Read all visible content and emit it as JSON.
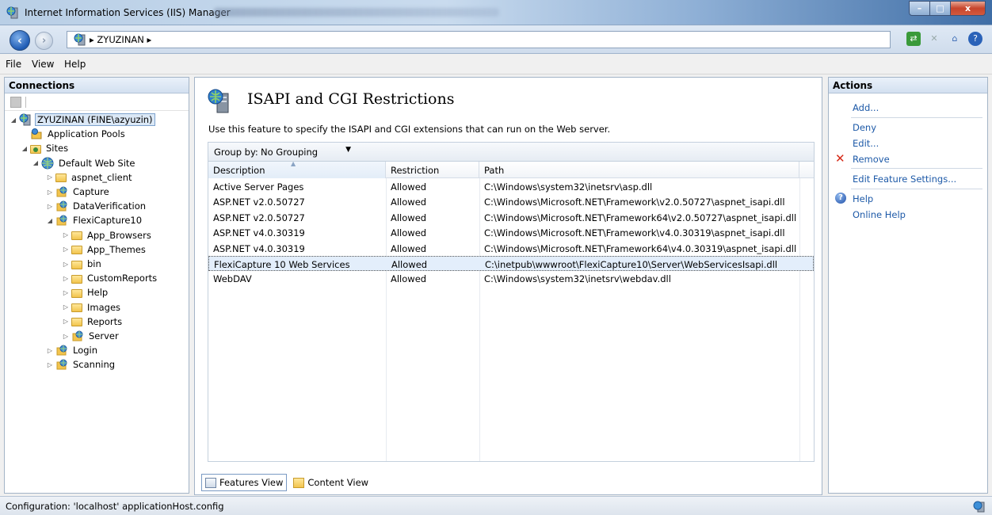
{
  "window": {
    "title": "Internet Information Services (IIS) Manager",
    "controls": {
      "minimize": "–",
      "maximize": "□",
      "close": "x"
    }
  },
  "address": {
    "crumb": "▸ ZYUZINAN ▸"
  },
  "menu": [
    {
      "label": "File"
    },
    {
      "label": "View"
    },
    {
      "label": "Help"
    }
  ],
  "connections": {
    "title": "Connections",
    "tree": [
      {
        "label": "ZYUZINAN (FINE\\azyuzin)",
        "icon": "server-icon",
        "level": 0,
        "expander": "◢",
        "selected": true
      },
      {
        "label": "Application Pools",
        "icon": "app-pools-icon",
        "level": 1,
        "expander": ""
      },
      {
        "label": "Sites",
        "icon": "sites-folder-icon",
        "level": 1,
        "expander": "◢"
      },
      {
        "label": "Default Web Site",
        "icon": "globe-icon",
        "level": 2,
        "expander": "◢"
      },
      {
        "label": "aspnet_client",
        "icon": "folder-icon",
        "level": 3,
        "expander": "▷"
      },
      {
        "label": "Capture",
        "icon": "web-app-icon",
        "level": 3,
        "expander": "▷"
      },
      {
        "label": "DataVerification",
        "icon": "web-app-icon",
        "level": 3,
        "expander": "▷"
      },
      {
        "label": "FlexiCapture10",
        "icon": "web-app-icon",
        "level": 3,
        "expander": "◢"
      },
      {
        "label": "App_Browsers",
        "icon": "folder-icon",
        "level": 4,
        "expander": "▷"
      },
      {
        "label": "App_Themes",
        "icon": "folder-icon",
        "level": 4,
        "expander": "▷"
      },
      {
        "label": "bin",
        "icon": "folder-icon",
        "level": 4,
        "expander": "▷"
      },
      {
        "label": "CustomReports",
        "icon": "folder-icon",
        "level": 4,
        "expander": "▷"
      },
      {
        "label": "Help",
        "icon": "folder-icon",
        "level": 4,
        "expander": "▷"
      },
      {
        "label": "Images",
        "icon": "folder-icon",
        "level": 4,
        "expander": "▷"
      },
      {
        "label": "Reports",
        "icon": "folder-icon",
        "level": 4,
        "expander": "▷"
      },
      {
        "label": "Server",
        "icon": "web-app-icon",
        "level": 4,
        "expander": "▷"
      },
      {
        "label": "Login",
        "icon": "web-app-icon",
        "level": 3,
        "expander": "▷"
      },
      {
        "label": "Scanning",
        "icon": "web-app-icon",
        "level": 3,
        "expander": "▷"
      }
    ]
  },
  "feature": {
    "title": "ISAPI and CGI Restrictions",
    "description": "Use this feature to specify the ISAPI and CGI extensions that can run on the Web server.",
    "group_by_label": "Group by:",
    "group_by_value": "No Grouping",
    "columns": [
      "Description",
      "Restriction",
      "Path"
    ],
    "rows": [
      {
        "description": "Active Server Pages",
        "restriction": "Allowed",
        "path": "C:\\Windows\\system32\\inetsrv\\asp.dll",
        "selected": false
      },
      {
        "description": "ASP.NET v2.0.50727",
        "restriction": "Allowed",
        "path": "C:\\Windows\\Microsoft.NET\\Framework\\v2.0.50727\\aspnet_isapi.dll",
        "selected": false
      },
      {
        "description": "ASP.NET v2.0.50727",
        "restriction": "Allowed",
        "path": "C:\\Windows\\Microsoft.NET\\Framework64\\v2.0.50727\\aspnet_isapi.dll",
        "selected": false
      },
      {
        "description": "ASP.NET v4.0.30319",
        "restriction": "Allowed",
        "path": "C:\\Windows\\Microsoft.NET\\Framework\\v4.0.30319\\aspnet_isapi.dll",
        "selected": false
      },
      {
        "description": "ASP.NET v4.0.30319",
        "restriction": "Allowed",
        "path": "C:\\Windows\\Microsoft.NET\\Framework64\\v4.0.30319\\aspnet_isapi.dll",
        "selected": false
      },
      {
        "description": "FlexiCapture 10 Web Services",
        "restriction": "Allowed",
        "path": "C:\\inetpub\\wwwroot\\FlexiCapture10\\Server\\WebServicesIsapi.dll",
        "selected": true
      },
      {
        "description": "WebDAV",
        "restriction": "Allowed",
        "path": "C:\\Windows\\system32\\inetsrv\\webdav.dll",
        "selected": false
      }
    ],
    "tabs": {
      "features": "Features View",
      "content": "Content View"
    }
  },
  "actions": {
    "title": "Actions",
    "items": {
      "add": "Add...",
      "deny": "Deny",
      "edit": "Edit...",
      "remove": "Remove",
      "edit_feature": "Edit Feature Settings...",
      "help": "Help",
      "online_help": "Online Help"
    }
  },
  "status": {
    "text": "Configuration: 'localhost' applicationHost.config"
  },
  "colors": {
    "link": "#1e5aa8",
    "remove": "#d62a18",
    "selection": "#e3eefb"
  }
}
